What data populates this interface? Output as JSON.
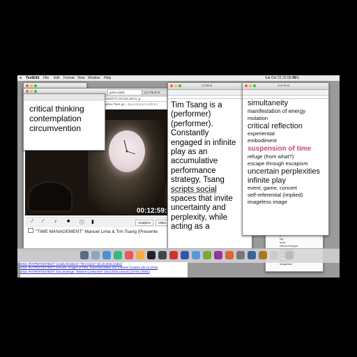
{
  "menubar": {
    "app": "TextEdit",
    "items": [
      "File",
      "Edit",
      "Format",
      "View",
      "Window",
      "Help"
    ],
    "clock": "Sat Oct 22 22:06:06",
    "battery": "79%"
  },
  "browser": {
    "tabs": [
      "gotcu.sp01",
      "(1) Parch E"
    ],
    "address": "watch?v=Nc1wLJwH4_g",
    "bookmarks": "Aphex Twin ge...   m o n k e p r o s h e t",
    "timestamp": "00:12:59:",
    "buttons": [
      "Analytics",
      "Video M"
    ],
    "caption": "\"TIME MANAGEMENT\" Manuel Lima & Tim Tsang (Presente"
  },
  "note_left": {
    "lines": [
      "critical thinking",
      "contemplation",
      "circumvention"
    ]
  },
  "note_middle": {
    "title": "Untitled",
    "lines": [
      "Tim Tsang is a",
      "(performer)",
      "(performer).",
      "Constantly",
      "engaged in infinite",
      "play as an",
      "accumulative",
      "performance",
      "strategy, Tsang",
      "scripts social",
      "spaces that invite",
      "uncertainty and",
      "perplexity, while",
      "acting as a"
    ]
  },
  "note_right": {
    "title": "text-final",
    "items": [
      {
        "text": "simultaneity",
        "size": "large"
      },
      {
        "text": "manifestation of energy",
        "size": "medium"
      },
      {
        "text": "mutation",
        "size": "small"
      },
      {
        "text": "critical reflection",
        "size": "large"
      },
      {
        "text": "experiential",
        "size": "small"
      },
      {
        "text": "embodiment",
        "size": "small"
      },
      {
        "text": "suspension of time",
        "size": "accent"
      },
      {
        "text": "refuge (from what?)",
        "size": "small"
      },
      {
        "text": "escape through escapism",
        "size": "small"
      },
      {
        "text": "uncertain perplexities",
        "size": "large"
      },
      {
        "text": "infinite play",
        "size": "large"
      },
      {
        "text": "event, game, concert",
        "size": "small"
      },
      {
        "text": "self-referential (implied)",
        "size": "small"
      },
      {
        "text": "imageless image",
        "size": "small"
      }
    ],
    "behind_list": [
      "tion",
      "mulation",
      "ualistic",
      "ncy",
      "n",
      "oration",
      "ar",
      "ness",
      "tive",
      "s",
      "ing",
      "ence",
      "critical thought",
      "experience",
      "embodiment",
      "refuge",
      "escape",
      "imageless"
    ]
  },
  "links": [
    "2015: RHYPERTEXTEDIT \"Lonely Emotions\" \"Tim Czyzer\" 02.10.2015 (Video)",
    "2015: RHYPERTEXTEDIT: Deleuze, Images of Time, Dimensionalities and Consent Creation (02.12.2015)",
    "2015: RHYPERTEXTEDIT: Tom Jennings: \"Women Consumers\" (03.8.2015 Lecture) 22?4% (Video)"
  ],
  "colors": {
    "accent": "#e0457b",
    "link": "#2222cc"
  }
}
